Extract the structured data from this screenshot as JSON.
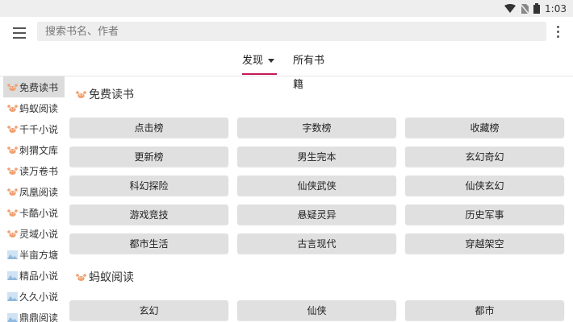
{
  "status_bar": {
    "time": "1:03"
  },
  "header": {
    "search_placeholder": "搜索书名、作者"
  },
  "tabs": [
    {
      "label": "发现",
      "active": true
    },
    {
      "label": "所有书籍",
      "active": false
    }
  ],
  "sidebar": {
    "items": [
      {
        "label": "免费读书",
        "icon": "crab-icon",
        "active": true
      },
      {
        "label": "蚂蚁阅读",
        "icon": "crab-icon"
      },
      {
        "label": "千千小说",
        "icon": "crab-icon"
      },
      {
        "label": "刺猬文库",
        "icon": "crab-icon"
      },
      {
        "label": "读万卷书",
        "icon": "crab-icon"
      },
      {
        "label": "凤凰阅读",
        "icon": "crab-icon"
      },
      {
        "label": "卡酷小说",
        "icon": "crab-icon"
      },
      {
        "label": "灵域小说",
        "icon": "crab-icon"
      },
      {
        "label": "半亩方塘",
        "icon": "image-icon"
      },
      {
        "label": "精品小说",
        "icon": "image-icon"
      },
      {
        "label": "久久小说",
        "icon": "image-icon"
      },
      {
        "label": "鼎鼎阅读",
        "icon": "image-icon"
      }
    ]
  },
  "sections": [
    {
      "title": "免费读书",
      "items": [
        "点击榜",
        "字数榜",
        "收藏榜",
        "更新榜",
        "男生完本",
        "玄幻奇幻",
        "科幻探险",
        "仙侠武侠",
        "仙侠玄幻",
        "游戏竞技",
        "悬疑灵异",
        "历史军事",
        "都市生活",
        "古言现代",
        "穿越架空"
      ]
    },
    {
      "title": "蚂蚁阅读",
      "items": [
        "玄幻",
        "仙侠",
        "都市"
      ]
    }
  ],
  "colors": {
    "accent": "#c2185b",
    "button_bg": "#e0e0e0",
    "crab": "#f0a070"
  }
}
